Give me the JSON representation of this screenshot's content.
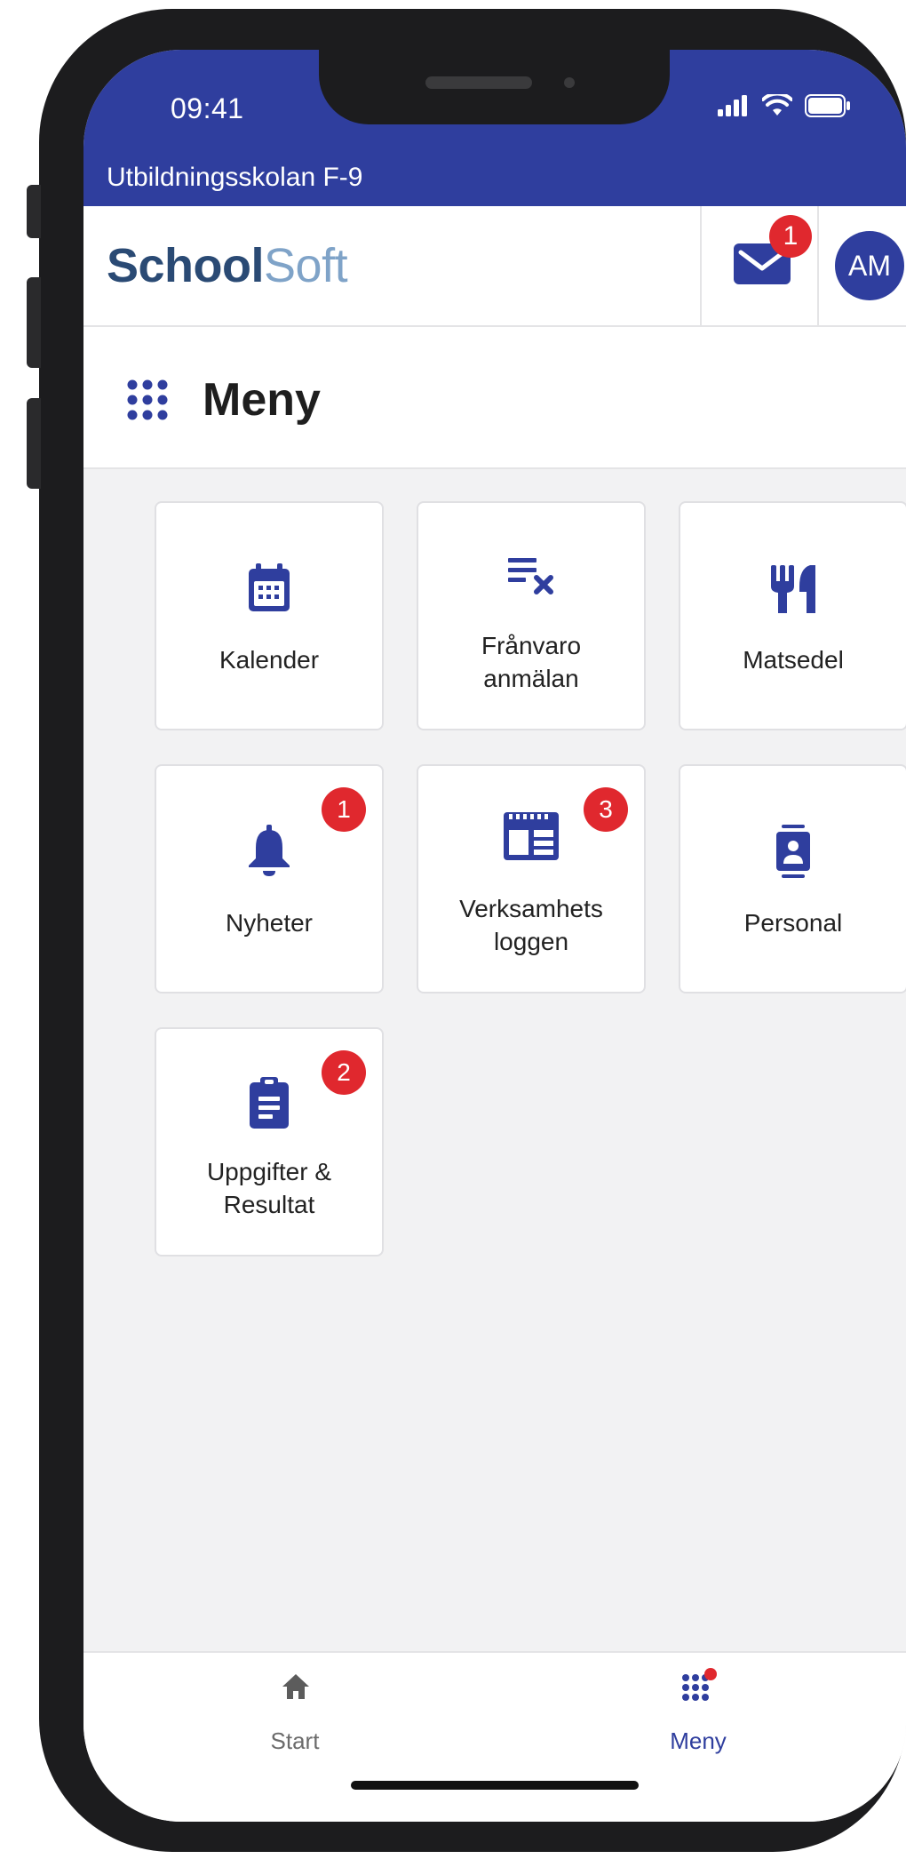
{
  "status_bar": {
    "time": "09:41"
  },
  "school": {
    "name": "Utbildningsskolan F-9"
  },
  "header": {
    "logo_part1": "School",
    "logo_part2": "Soft",
    "mail_badge": "1",
    "avatar_initials": "AM"
  },
  "page": {
    "title": "Meny"
  },
  "tiles": [
    {
      "label": "Kalender",
      "icon": "calendar-icon",
      "badge": ""
    },
    {
      "label": "Frånvaro\nanmälan",
      "icon": "absence-list-icon",
      "badge": ""
    },
    {
      "label": "Matsedel",
      "icon": "cutlery-icon",
      "badge": ""
    },
    {
      "label": "Nyheter",
      "icon": "bell-icon",
      "badge": "1"
    },
    {
      "label": "Verksamhets\nloggen",
      "icon": "log-icon",
      "badge": "3"
    },
    {
      "label": "Personal",
      "icon": "staff-badge-icon",
      "badge": ""
    },
    {
      "label": "Uppgifter &\nResultat",
      "icon": "clipboard-icon",
      "badge": "2"
    }
  ],
  "bottom_nav": {
    "start_label": "Start",
    "meny_label": "Meny"
  },
  "colors": {
    "primary": "#2f3e9e",
    "badge": "#e0282e",
    "background": "#f2f2f3",
    "nav_inactive": "#6b6b6b"
  }
}
